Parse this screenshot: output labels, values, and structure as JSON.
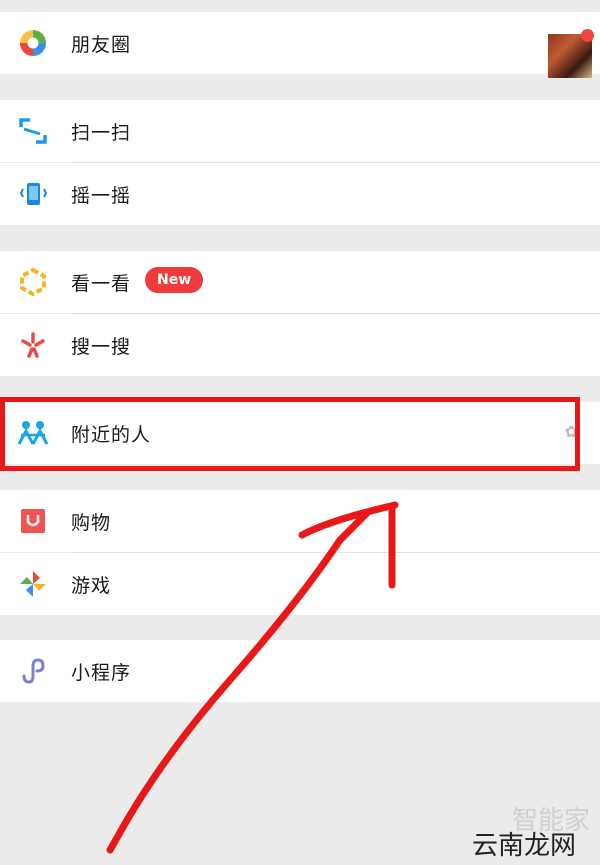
{
  "menu": {
    "moments": {
      "label": "朋友圈",
      "icon": "moments-aperture-icon"
    },
    "scan": {
      "label": "扫一扫",
      "icon": "scan-icon"
    },
    "shake": {
      "label": "摇一摇",
      "icon": "shake-phone-icon"
    },
    "top_stories": {
      "label": "看一看",
      "icon": "top-stories-icon",
      "badge": "New"
    },
    "search": {
      "label": "搜一搜",
      "icon": "search-star-icon"
    },
    "people_nearby": {
      "label": "附近的人",
      "icon": "people-nearby-icon"
    },
    "shopping": {
      "label": "购物",
      "icon": "shopping-bag-icon"
    },
    "games": {
      "label": "游戏",
      "icon": "games-icon"
    },
    "mini_programs": {
      "label": "小程序",
      "icon": "mini-programs-icon"
    }
  },
  "annotation": {
    "color": "#e81818"
  },
  "watermark": {
    "line1": "智能家",
    "line2": "云南龙网"
  },
  "colors": {
    "background": "#ebebeb",
    "badge": "#ef3b3b",
    "scan": "#1a9be8",
    "people": "#1aa5e6"
  }
}
